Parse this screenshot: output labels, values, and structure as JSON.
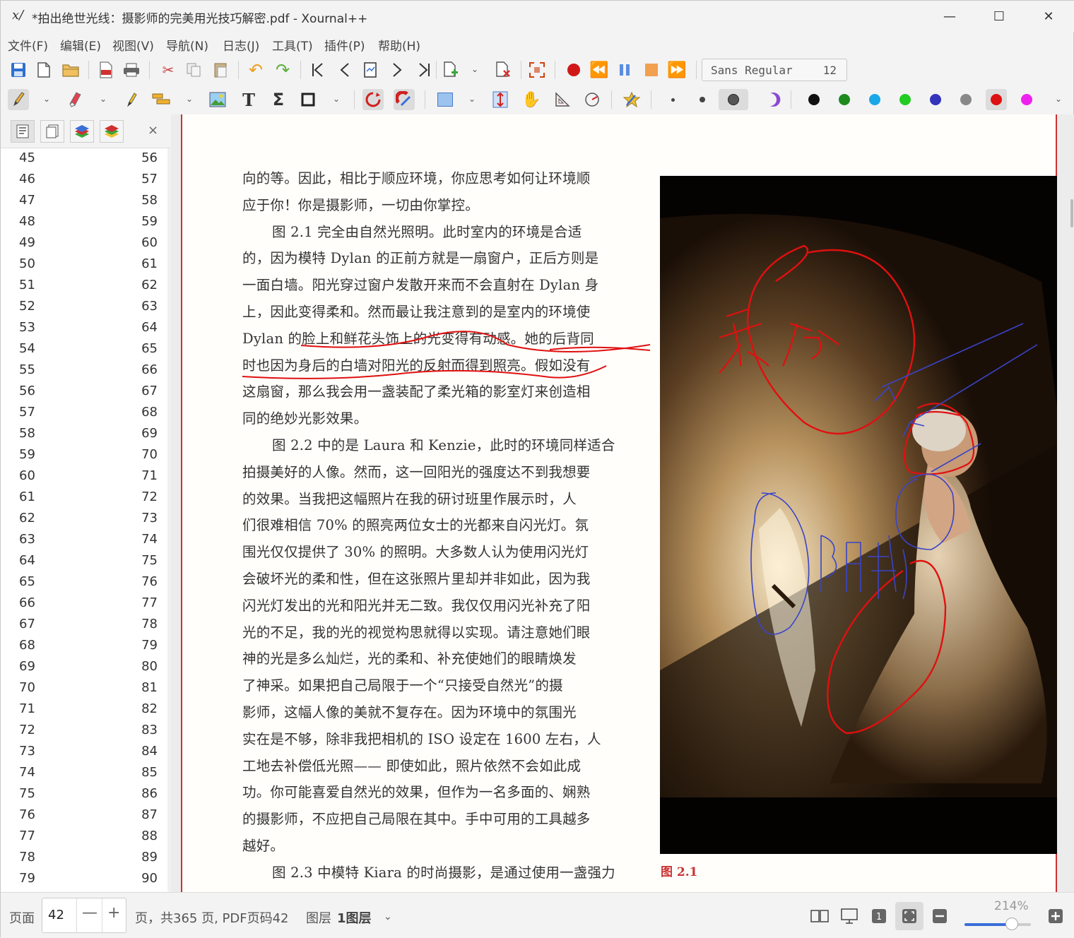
{
  "window": {
    "app_icon": "x/",
    "title": "*拍出绝世光线：摄影师的完美用光技巧解密.pdf - Xournal++",
    "minimize": "—",
    "maximize": "☐",
    "close": "✕"
  },
  "menu": [
    "文件(F)",
    "编辑(E)",
    "视图(V)",
    "导航(N)",
    "日志(J)",
    "工具(T)",
    "插件(P)",
    "帮助(H)"
  ],
  "toolbar1": {
    "icons": [
      "save-icon",
      "new-document-icon",
      "open-folder-icon",
      "export-pdf-icon",
      "print-icon",
      "cut-icon",
      "copy-icon",
      "paste-icon",
      "undo-icon",
      "redo-icon",
      "first-page-icon",
      "previous-page-icon",
      "goto-page-icon",
      "next-page-icon",
      "last-page-icon",
      "insert-page-icon",
      "delete-page-icon",
      "fullscreen-icon",
      "record-icon",
      "rewind-icon",
      "pause-icon",
      "stop-icon",
      "fast-forward-icon"
    ],
    "font_name": "Sans Regular",
    "font_size": "12"
  },
  "toolbar2": {
    "icons": [
      "pen-icon",
      "eraser-icon",
      "highlighter-icon",
      "text-tool-icon",
      "image-icon",
      "text-icon",
      "math-tex-icon",
      "shape-rectangle-icon",
      "shape-recognizer-icon",
      "ruler-icon",
      "select-rectangle-icon",
      "vertical-space-icon",
      "hand-icon",
      "set-square-icon",
      "compass-icon",
      "default-tool-icon",
      "fine-thickness-icon",
      "medium-thickness-icon",
      "thick-thickness-icon",
      "fill-icon"
    ],
    "colors": [
      "#111111",
      "#1e8a1e",
      "#1aa7e8",
      "#22cc22",
      "#3333bb",
      "#888888",
      "#dd1111",
      "#ee22ee"
    ],
    "selected_color_index": 6
  },
  "sidebar": {
    "tabs": [
      "page-index-icon",
      "page-preview-icon",
      "layers-icon",
      "layer-stack-icon"
    ],
    "close": "×",
    "index_rows": [
      [
        "45",
        "56"
      ],
      [
        "46",
        "57"
      ],
      [
        "47",
        "58"
      ],
      [
        "48",
        "59"
      ],
      [
        "49",
        "60"
      ],
      [
        "50",
        "61"
      ],
      [
        "51",
        "62"
      ],
      [
        "52",
        "63"
      ],
      [
        "53",
        "64"
      ],
      [
        "54",
        "65"
      ],
      [
        "55",
        "66"
      ],
      [
        "56",
        "67"
      ],
      [
        "57",
        "68"
      ],
      [
        "58",
        "69"
      ],
      [
        "59",
        "70"
      ],
      [
        "60",
        "71"
      ],
      [
        "61",
        "72"
      ],
      [
        "62",
        "73"
      ],
      [
        "63",
        "74"
      ],
      [
        "64",
        "75"
      ],
      [
        "65",
        "76"
      ],
      [
        "66",
        "77"
      ],
      [
        "67",
        "78"
      ],
      [
        "68",
        "79"
      ],
      [
        "69",
        "80"
      ],
      [
        "70",
        "81"
      ],
      [
        "71",
        "82"
      ],
      [
        "72",
        "83"
      ],
      [
        "73",
        "84"
      ],
      [
        "74",
        "85"
      ],
      [
        "75",
        "86"
      ],
      [
        "76",
        "87"
      ],
      [
        "77",
        "88"
      ],
      [
        "78",
        "89"
      ],
      [
        "79",
        "90"
      ]
    ]
  },
  "document": {
    "lines": [
      "向的等。因此，相比于顺应环境，你应思考如何让环境顺",
      "应于你！你是摄影师，一切由你掌控。",
      "图 2.1 完全由自然光照明。此时室内的环境是合适",
      "的，因为模特 Dylan 的正前方就是一扇窗户，正后方则是",
      "一面白墙。阳光穿过窗户发散开来而不会直射在 Dylan 身",
      "上，因此变得柔和。然而最让我注意到的是室内的环境使",
      "Dylan 的脸上和鲜花头饰上的光变得有动感。她的后背同",
      "时也因为身后的白墙对阳光的反射而得到照亮。假如没有",
      "这扇窗，那么我会用一盏装配了柔光箱的影室灯来创造相",
      "同的绝妙光影效果。",
      "图 2.2 中的是 Laura 和 Kenzie，此时的环境同样适合",
      "拍摄美好的人像。然而，这一回阳光的强度达不到我想要",
      "的效果。当我把这幅照片在我的研讨班里作展示时，人",
      "们很难相信 70% 的照亮两位女士的光都来自闪光灯。氛",
      "围光仅仅提供了 30% 的照明。大多数人认为使用闪光灯",
      "会破坏光的柔和性，但在这张照片里却并非如此，因为我",
      "闪光灯发出的光和阳光并无二致。我仅仅用闪光补充了阳",
      "光的不足，我的光的视觉构思就得以实现。请注意她们眼",
      "神的光是多么灿烂，光的柔和、补充使她们的眼睛焕发",
      "了神采。如果把自己局限于一个“只接受自然光”的摄",
      "影师，这幅人像的美就不复存在。因为环境中的氛围光",
      "实在是不够，除非我把相机的 ISO 设定在 1600 左右，人",
      "工地去补偿低光照—— 即使如此，照片依然不会如此成",
      "功。你可能喜爱自然光的效果，但作为一名多面的、娴熟",
      "的摄影师，不应把自己局限在其中。手中可用的工具越多",
      "越好。",
      "图 2.3 中模特 Kiara 的时尚摄影，是通过使用一盏强力"
    ],
    "indent_lines": [
      2,
      10,
      26
    ],
    "caption": "图 2.1",
    "annotation_text_red": "柔和",
    "annotation_text_blue": "阴影"
  },
  "statusbar": {
    "page_label": "页面",
    "page_value": "42",
    "minus": "—",
    "plus": "+",
    "page_info": "页，共365 页, PDF页码42",
    "layer_label": "图层",
    "layer_value": "1图层",
    "layer_dropdown": "⌄",
    "zoom": "214%",
    "zoom_fraction": 0.71,
    "view_icons": [
      "two-page-icon",
      "presentation-icon",
      "page-number-icon",
      "zoom-fit-icon",
      "zoom-out-icon",
      "zoom-in-icon"
    ]
  }
}
